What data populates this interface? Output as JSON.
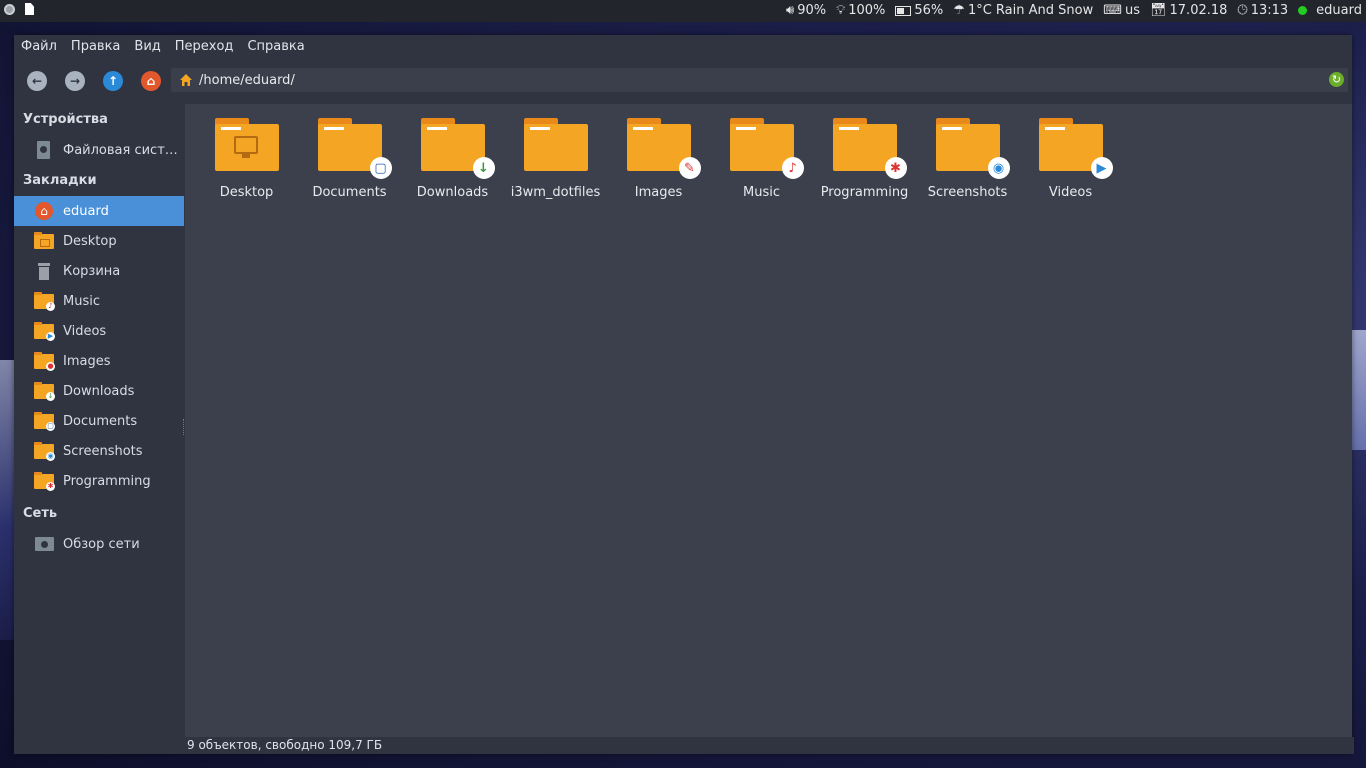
{
  "topbar": {
    "volume": "90%",
    "brightness": "100%",
    "battery": "56%",
    "weather": "1°C Rain And Snow",
    "keyboard": "us",
    "date": "17.02.18",
    "time": "13:13",
    "user": "eduard",
    "user_status_color": "#22cc22"
  },
  "menubar": [
    "Файл",
    "Правка",
    "Вид",
    "Переход",
    "Справка"
  ],
  "toolbar": {
    "path": "/home/eduard/"
  },
  "sidebar": {
    "devices_heading": "Устройства",
    "devices": [
      {
        "label": "Файловая сист…",
        "icon": "drive-icon"
      }
    ],
    "bookmarks_heading": "Закладки",
    "bookmarks": [
      {
        "label": "eduard",
        "icon": "home-icon",
        "active": true
      },
      {
        "label": "Desktop",
        "icon": "desktop-folder-icon"
      },
      {
        "label": "Корзина",
        "icon": "trash-icon"
      },
      {
        "label": "Music",
        "icon": "music-folder-icon"
      },
      {
        "label": "Videos",
        "icon": "videos-folder-icon"
      },
      {
        "label": "Images",
        "icon": "images-folder-icon"
      },
      {
        "label": "Downloads",
        "icon": "downloads-folder-icon"
      },
      {
        "label": "Documents",
        "icon": "documents-folder-icon"
      },
      {
        "label": "Screenshots",
        "icon": "screenshots-folder-icon"
      },
      {
        "label": "Programming",
        "icon": "programming-folder-icon"
      }
    ],
    "network_heading": "Сеть",
    "network": [
      {
        "label": "Обзор сети",
        "icon": "network-icon"
      }
    ]
  },
  "content": {
    "items": [
      {
        "label": "Desktop",
        "icon": "desktop-folder-icon"
      },
      {
        "label": "Documents",
        "icon": "documents-folder-icon"
      },
      {
        "label": "Downloads",
        "icon": "downloads-folder-icon"
      },
      {
        "label": "i3wm_dotfiles",
        "icon": "folder-icon"
      },
      {
        "label": "Images",
        "icon": "images-folder-icon"
      },
      {
        "label": "Music",
        "icon": "music-folder-icon"
      },
      {
        "label": "Programming",
        "icon": "programming-folder-icon"
      },
      {
        "label": "Screenshots",
        "icon": "screenshots-folder-icon"
      },
      {
        "label": "Videos",
        "icon": "videos-folder-icon"
      }
    ]
  },
  "statusbar": {
    "text": "9 объектов, свободно 109,7 ГБ"
  },
  "colors": {
    "folder": "#f5a524",
    "folder_tab": "#e8891a",
    "selection": "#4a90d9",
    "window_bg": "#2f3440",
    "content_bg": "#3b404c"
  }
}
